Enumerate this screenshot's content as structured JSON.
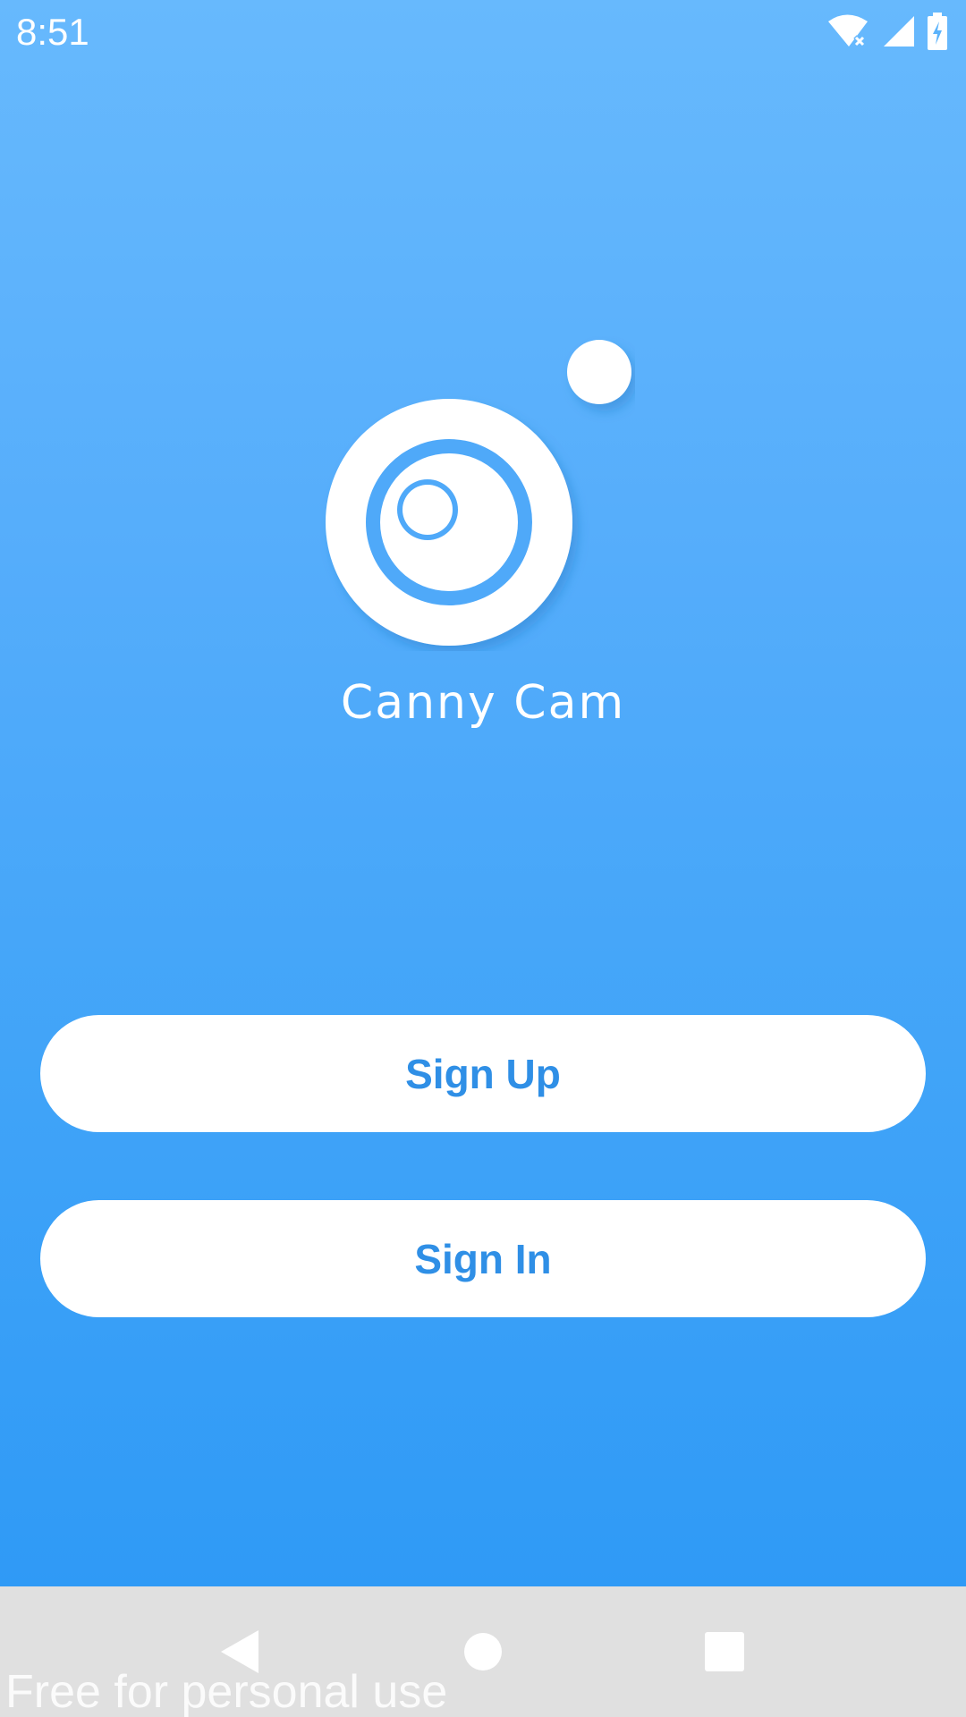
{
  "status_bar": {
    "time": "8:51",
    "icons": [
      "wifi-off-icon",
      "signal-icon",
      "battery-charging-icon"
    ]
  },
  "app": {
    "name": "Canny Cam",
    "logo_icon": "camera-logo-icon"
  },
  "buttons": {
    "sign_up": "Sign Up",
    "sign_in": "Sign In"
  },
  "nav_bar": {
    "icons": [
      "back-icon",
      "home-icon",
      "recents-icon"
    ]
  },
  "watermark": "Free for personal use",
  "colors": {
    "gradient_top": "#67b9fd",
    "gradient_bottom": "#2f9af6",
    "button_bg": "#ffffff",
    "button_text": "#2f8fe6",
    "nav_bar_bg": "#e0e0e0"
  }
}
